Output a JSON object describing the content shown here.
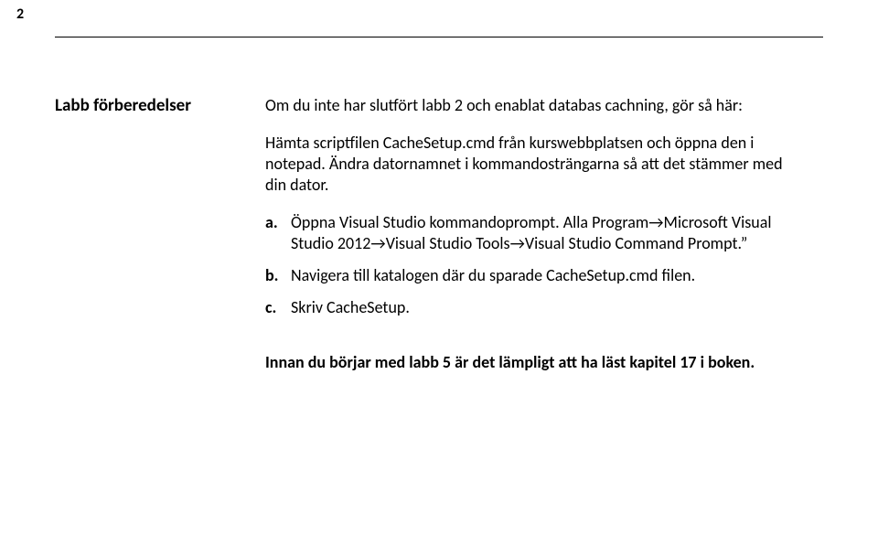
{
  "page_number": "2",
  "section_title": "Labb förberedelser",
  "intro_line": "Om du inte har slutfört labb 2 och enablat databas cachning, gör så här:",
  "para1": "Hämta scriptfilen CacheSetup.cmd från kurswebbplatsen och öppna den i notepad. Ändra datornamnet i kommandosträngarna så att det stämmer med din dator.",
  "steps": [
    {
      "marker": "a.",
      "text": "Öppna Visual Studio kommandoprompt. Alla Program→Microsoft Visual Studio 2012→Visual Studio Tools→Visual Studio Command Prompt.”"
    },
    {
      "marker": "b.",
      "text": "Navigera till katalogen där du sparade CacheSetup.cmd filen."
    },
    {
      "marker": "c.",
      "text": "Skriv CacheSetup."
    }
  ],
  "footer": "Innan du börjar med labb 5 är det lämpligt att ha läst kapitel 17 i boken."
}
